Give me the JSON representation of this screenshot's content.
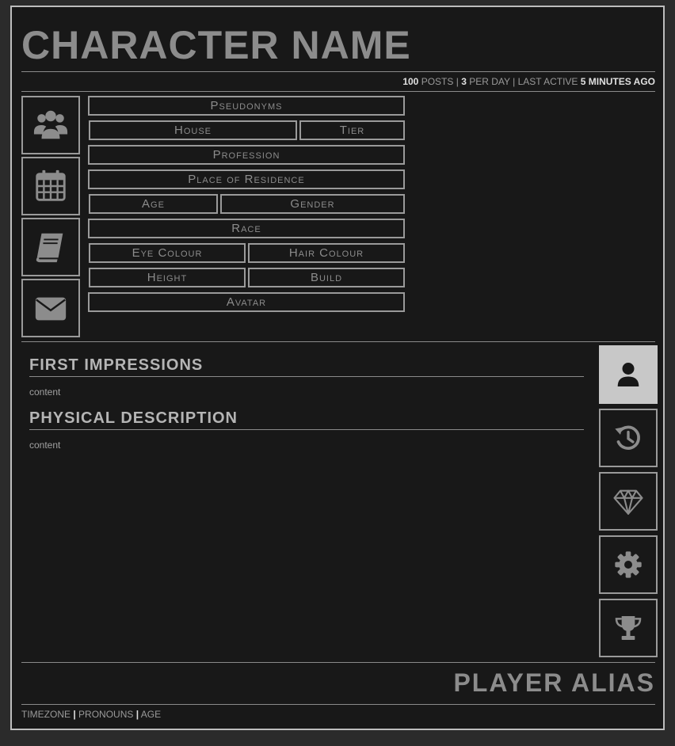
{
  "header": {
    "character_name": "CHARACTER NAME",
    "stats": {
      "posts_count": "100",
      "posts_label": "POSTS",
      "sep1": "|",
      "per_day_count": "3",
      "per_day_label": "PER DAY",
      "sep2": "|",
      "last_active_label": "LAST ACTIVE",
      "last_active_value": "5 MINUTES AGO"
    }
  },
  "left_icons": [
    "users-icon",
    "calendar-icon",
    "book-icon",
    "envelope-icon"
  ],
  "fields": {
    "pseudonyms": "Pseudonyms",
    "house": "House",
    "tier": "Tier",
    "profession": "Profession",
    "residence": "Place of Residence",
    "age": "Age",
    "gender": "Gender",
    "race": "Race",
    "eye_colour": "Eye Colour",
    "hair_colour": "Hair Colour",
    "height": "Height",
    "build": "Build",
    "avatar": "Avatar"
  },
  "sections": {
    "first_impressions": {
      "title": "FIRST IMPRESSIONS",
      "content": "content"
    },
    "physical_description": {
      "title": "PHYSICAL DESCRIPTION",
      "content": "content"
    }
  },
  "side_tabs": [
    "user-icon",
    "history-icon",
    "gem-icon",
    "gear-icon",
    "trophy-icon"
  ],
  "footer": {
    "player_alias": "PLAYER ALIAS",
    "timezone": "TIMEZONE",
    "sep1": "|",
    "pronouns": "PRONOUNS",
    "sep2": "|",
    "age": "AGE"
  },
  "colors": {
    "background": "#181818",
    "border": "#9a9a9a",
    "text": "#8c8c8c",
    "active_tab": "#c8c8c8"
  }
}
